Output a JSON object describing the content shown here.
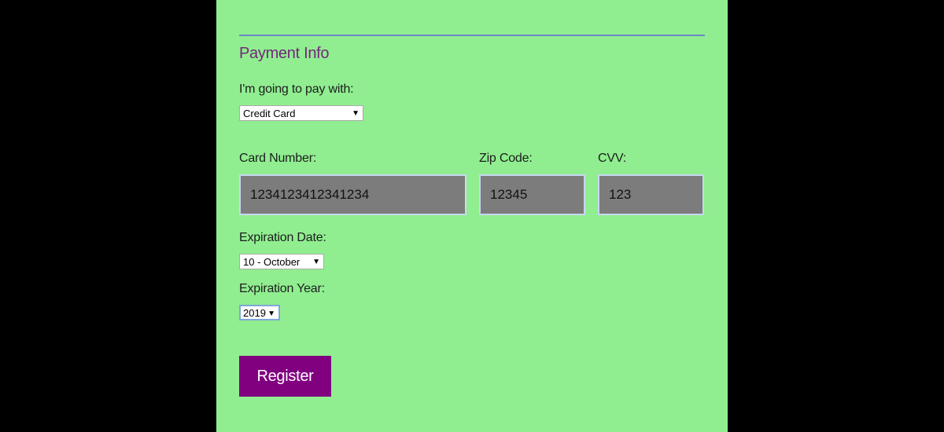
{
  "payment": {
    "title": "Payment Info",
    "pay_with_label": "I'm going to pay with:",
    "pay_with_value": "Credit Card",
    "card_number_label": "Card Number:",
    "card_number_value": "1234123412341234",
    "zip_label": "Zip Code:",
    "zip_value": "12345",
    "cvv_label": "CVV:",
    "cvv_value": "123",
    "exp_date_label": "Expiration Date:",
    "exp_date_value": "10 - October",
    "exp_year_label": "Expiration Year:",
    "exp_year_value": "2019",
    "register_label": "Register"
  },
  "colors": {
    "page_background": "#90ee90",
    "outer_background": "#000000",
    "title_color": "#76257f",
    "button_color": "#800080",
    "input_background": "#7c7c7c",
    "divider_color": "#6f86c6"
  },
  "icons": {
    "dropdown": "dropdown-arrow-icon"
  }
}
